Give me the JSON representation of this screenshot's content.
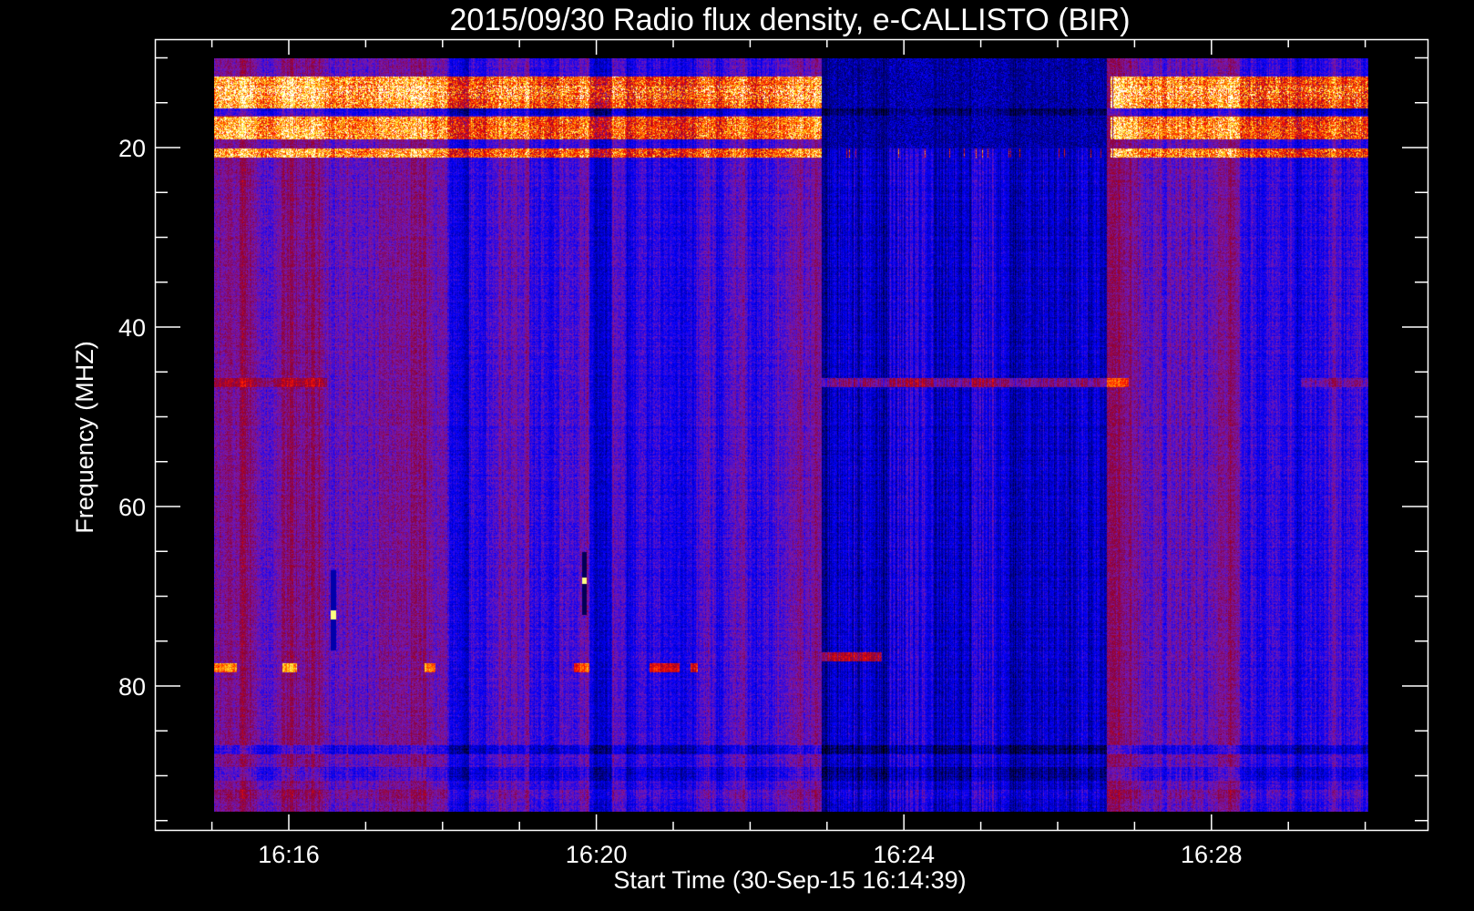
{
  "chart_data": {
    "type": "heatmap",
    "title": "2015/09/30  Radio flux density, e-CALLISTO (BIR)",
    "xlabel": "Start Time (30-Sep-15 16:14:39)",
    "ylabel": "Frequency (MHZ)",
    "x_unit": "minutes after 16:16 UT",
    "x_ticks": [
      {
        "label": "16:16",
        "value": 0
      },
      {
        "label": "16:20",
        "value": 4
      },
      {
        "label": "16:24",
        "value": 8
      },
      {
        "label": "16:28",
        "value": 12
      }
    ],
    "x_minor_step": 1,
    "xlim": [
      -1.74,
      14.8
    ],
    "data_time_range": [
      "16:14:39",
      "16:30:02"
    ],
    "y_ticks": [
      {
        "label": "20",
        "value": 20
      },
      {
        "label": "40",
        "value": 40
      },
      {
        "label": "60",
        "value": 60
      },
      {
        "label": "80",
        "value": 80
      }
    ],
    "y_minor_step": 5,
    "ylim": [
      96,
      8
    ],
    "data_freq_range": [
      10,
      94
    ],
    "colormap": [
      "#000000",
      "#0000ff",
      "#7a1ab0",
      "#8c0030",
      "#ff1000",
      "#ff9000",
      "#ffff40",
      "#ffffff"
    ],
    "features": {
      "low_signal_interval_min": [
        6.75,
        10.6
      ],
      "bright_band_mhz": [
        10,
        21
      ],
      "narrowband_lines_mhz": [
        46,
        78
      ],
      "grid": false
    }
  }
}
